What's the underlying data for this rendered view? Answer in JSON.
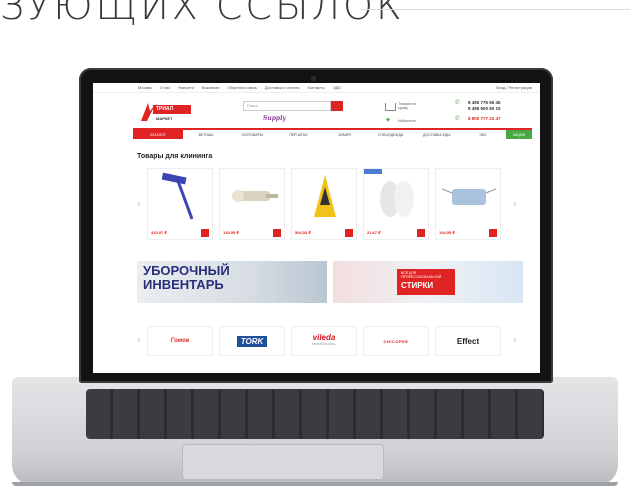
{
  "page_heading": "ЗУЮЩИХ ССЫЛОК",
  "website": {
    "topbar": {
      "links": [
        "Москва",
        "О нас",
        "Новости",
        "Вакансии",
        "Обратная связь",
        "Доставка и оплата",
        "Контакты",
        "ЭДО"
      ],
      "login": "Вход / Регистрация"
    },
    "logo": {
      "brand": "ТРИАЛ",
      "sub": "МАРКЕТ"
    },
    "search_placeholder": "Поиск",
    "supply_label": "Supply",
    "cart_label": "Товаров на сумму",
    "favorites_label": "Избранное",
    "phones": [
      "8 495 775 65 45",
      "8 495 500 60 15",
      "8 800 777 22 47"
    ],
    "nav": {
      "catalog": "КАТАЛОГ",
      "items": [
        "ВЕТОШЬ",
        "ХОЗТОВАРЫ",
        "ПЕРЧАТКИ",
        "ХИМИЯ",
        "СПЕЦОДЕЖДА",
        "ДОСТАВКА ЕДЫ",
        "ЭКО"
      ],
      "green_label": "АКЦИИ"
    },
    "section_title": "Товары для клининга",
    "products": [
      {
        "name": "mop",
        "price": "410,97 ₽"
      },
      {
        "name": "wringer",
        "price": "130,55 ₽"
      },
      {
        "name": "wet-floor-sign",
        "price": "594,53 ₽"
      },
      {
        "name": "gloves",
        "price": "21,67 ₽"
      },
      {
        "name": "face-mask",
        "price": "194,55 ₽"
      }
    ],
    "banner_left": {
      "line1": "УБОРОЧНЫЙ",
      "line2": "ИНВЕНТАРЬ"
    },
    "banner_right": {
      "small": "ВСЁ ДЛЯ ПРОФЕССИОНАЛЬНОЙ",
      "big": "СТИРКИ"
    },
    "brands": [
      "Гомое",
      "TORK",
      "vileda",
      "CHICOPEE",
      "Effect"
    ],
    "vileda_sub": "PROFESSIONAL"
  },
  "colors": {
    "accent": "#e02424",
    "green": "#4aa843"
  }
}
